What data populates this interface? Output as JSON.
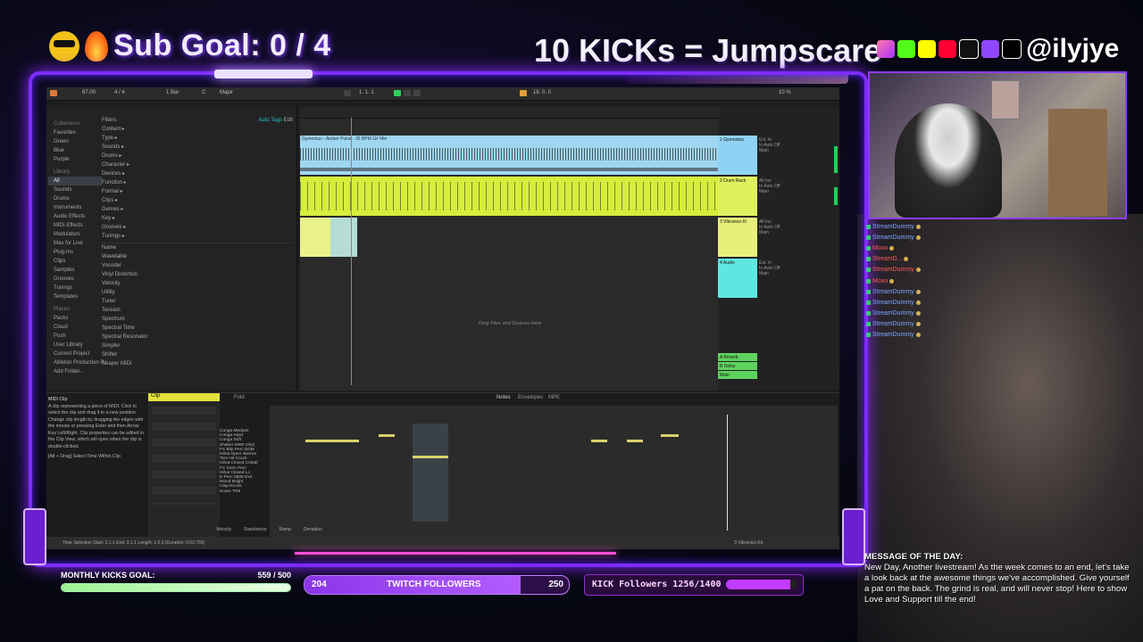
{
  "header": {
    "sub_goal": "Sub Goal: 0 / 4",
    "jumpscare": "10 KICKs = Jumpscare",
    "handle": "@ilyjye"
  },
  "daw": {
    "topbar": {
      "tempo": "87.00",
      "meter": "4 / 4",
      "bar": "1 Bar",
      "key": "C",
      "scale": "Major",
      "position": "1. 1. 1",
      "loop_end": "18. 0. 0",
      "cpu": "10 %"
    },
    "browser": {
      "collections_label": "Collections",
      "collections": [
        "Favorites",
        "Green",
        "Blue",
        "Purple"
      ],
      "library_label": "Library",
      "library": [
        "All",
        "Sounds",
        "Drums",
        "Instruments",
        "Audio Effects",
        "MIDI Effects",
        "Modulators",
        "Max for Live",
        "Plug-Ins",
        "Clips",
        "Samples",
        "Grooves",
        "Tunings",
        "Templates"
      ],
      "places_label": "Places",
      "places": [
        "Packs",
        "Cloud",
        "Push",
        "User Library",
        "Current Project",
        "Ableton Production P...",
        "Add Folder..."
      ],
      "filters_label": "Filters",
      "auto_tags": "Auto Tags",
      "edit": "Edit",
      "filters": [
        "Content ▸",
        "Type ▸",
        "Sounds ▸",
        "Drums ▸",
        "Character ▸",
        "Devices ▸",
        "Function ▸",
        "Format ▸",
        "Clips ▸",
        "Genres ▸",
        "Key ▸",
        "Grooves ▸",
        "Tunings ▸"
      ],
      "name_col": "Name",
      "devices": [
        "Wavetable",
        "Vocoder",
        "Vinyl Distortion",
        "Velocity",
        "Utility",
        "Tuner",
        "Tension",
        "Spectrum",
        "Spectral Time",
        "Spectral Resonator",
        "Simpler",
        "Shifter",
        "Shaper MIDI"
      ]
    },
    "arrangement": {
      "clip_name": "Gymnotus - Amber Pulse - 32 BPM G# Min",
      "drop_hint": "Drop Files and Devices Here",
      "tracks": [
        {
          "name": "1 Gymnotus",
          "color": "#8fd3f4"
        },
        {
          "name": "2 Drum Rack",
          "color": "#dff05e"
        },
        {
          "name": "3 Vibranics Ki",
          "color": "#e8f07a"
        },
        {
          "name": "4 Audio",
          "color": "#5ee7e1"
        }
      ],
      "returns": [
        {
          "name": "A Reverb",
          "color": "#5fd35f"
        },
        {
          "name": "B Delay",
          "color": "#5fd35f"
        },
        {
          "name": "Main",
          "color": "#5fd35f"
        }
      ],
      "io_labels": [
        "Ext. In",
        "All Ins",
        "In Auto Off",
        "Main"
      ]
    },
    "detail": {
      "info_title": "MIDI Clip",
      "info_text": "A clip representing a piece of MIDI. Click to select the clip and drag it to a new position. Change clip length by dragging the edges with the mouse or pressing Enter and then Arrow Key Left/Right. Clip properties can be edited in the Clip View, which will open when the clip is double-clicked.",
      "info_hint": "[Alt + Drag] Select Time Within Clip",
      "clip_label": "Clip",
      "fold": "Fold",
      "notes_tab": "Notes",
      "envelopes_tab": "Envelopes",
      "mpe_tab": "MPE",
      "drum_names": [
        "Conga Medium",
        "Conga Hard",
        "Conga Soft",
        "Shaker 0800 Vinyl",
        "FX Blip Perc EDM",
        "Hihat Open Warma",
        "Tom Hit Crush",
        "Hihat Closed Cristal",
        "FX Siren Perc",
        "Hihat Closed LJ",
        "E-Perc 0808 Exit",
        "Wood Bright",
        "Clap Knock",
        "Snare TR8"
      ],
      "velocity": "Velocity",
      "randomize": "Randomize",
      "ramp": "Ramp",
      "deviation": "Deviation"
    },
    "statusbar": {
      "left": "Time Selection  Start: 2.1.1   End: 3.1.1   Length: 1.0.0 (Duration: 0:02:759)",
      "right": "3-Vibranics Kit"
    }
  },
  "chat": [
    {
      "user": "StreamDummy",
      "color": "#7ea7ff"
    },
    {
      "user": "StreamDummy",
      "color": "#7ea7ff"
    },
    {
      "user": "Moxo",
      "color": "#ff5b5b"
    },
    {
      "user": "StreamD...",
      "color": "#ff5b5b"
    },
    {
      "user": "StreamDummy",
      "color": "#ff5b5b"
    },
    {
      "user": "Moxo",
      "color": "#ff5b5b"
    },
    {
      "user": "StreamDummy",
      "color": "#7ea7ff"
    },
    {
      "user": "StreamDummy",
      "color": "#7ea7ff"
    },
    {
      "user": "StreamDummy",
      "color": "#7ea7ff"
    },
    {
      "user": "StreamDummy",
      "color": "#7ea7ff"
    },
    {
      "user": "StreamDummy",
      "color": "#7ea7ff"
    }
  ],
  "motd": {
    "title": "MESSAGE OF THE DAY:",
    "text": "New Day, Another livestream! As the week comes to an end, let's take a look back at the awesome things we've accomplished. Give yourself a pat on the back. The grind is real, and will never stop! Here to show Love and Support till the end!"
  },
  "goals": {
    "monthly_label": "MONTHLY KICKS GOAL:",
    "monthly_value": "559 / 500",
    "monthly_progress": 1.0,
    "twitch_current": "204",
    "twitch_label": "TWITCH FOLLOWERS",
    "twitch_target": "250",
    "twitch_progress": 0.816,
    "kick_label": "KICK Followers 1256/1400",
    "kick_progress": 0.897
  }
}
